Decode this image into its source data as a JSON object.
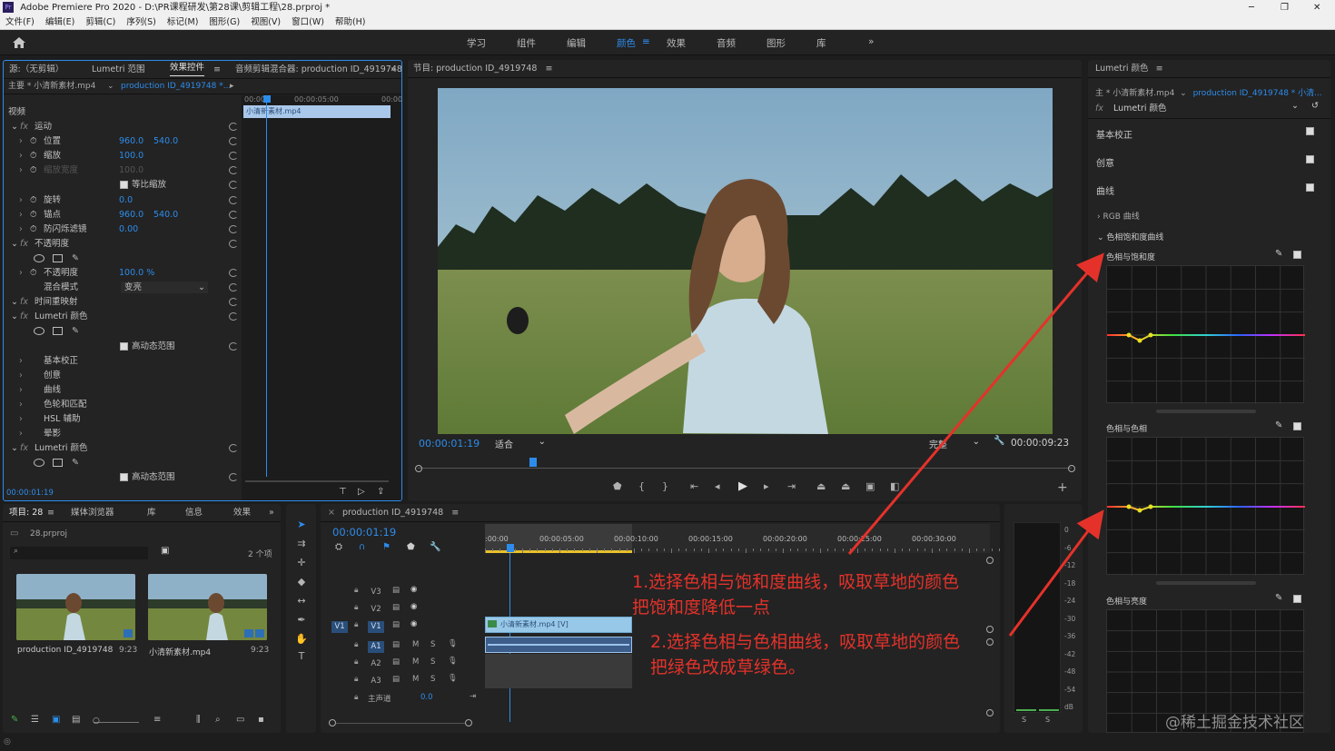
{
  "app_title": "Adobe Premiere Pro 2020 - D:\\PR课程研发\\第28课\\剪辑工程\\28.prproj *",
  "window_controls": [
    "─",
    "❐",
    "✕"
  ],
  "menu": [
    "文件(F)",
    "编辑(E)",
    "剪辑(C)",
    "序列(S)",
    "标记(M)",
    "图形(G)",
    "视图(V)",
    "窗口(W)",
    "帮助(H)"
  ],
  "workspaces": [
    "学习",
    "组件",
    "编辑",
    "颜色",
    "效果",
    "音频",
    "图形",
    "库"
  ],
  "workspace_more": "»",
  "source_panel": {
    "tabs": [
      "源:（无剪辑）",
      "Lumetri 范围",
      "效果控件",
      "音频剪辑混合器: production ID_4919748"
    ],
    "active_tab": "效果控件",
    "master": "主要 * 小清新素材.mp4",
    "sequence": "production ID_4919748 *...",
    "ruler": [
      "00:00",
      "00:00:05:00",
      "00:00"
    ],
    "clip_name": "小清新素材.mp4",
    "section": "视频",
    "rows": [
      {
        "label": "运动",
        "indent": 0,
        "fx": true
      },
      {
        "label": "位置",
        "v1": "960.0",
        "v2": "540.0"
      },
      {
        "label": "缩放",
        "v1": "100.0"
      },
      {
        "label": "缩放宽度",
        "v1": "100.0",
        "dim": true
      },
      {
        "label": "等比缩放",
        "checkbox": true
      },
      {
        "label": "旋转",
        "v1": "0.0"
      },
      {
        "label": "锚点",
        "v1": "960.0",
        "v2": "540.0"
      },
      {
        "label": "防闪烁滤镜",
        "v1": "0.00"
      },
      {
        "label": "不透明度",
        "fx": true
      },
      {
        "label": "mask-tools"
      },
      {
        "label": "不透明度",
        "v1": "100.0 %"
      },
      {
        "label": "混合模式",
        "select": "变亮"
      },
      {
        "label": "时间重映射",
        "fx": true
      },
      {
        "label": "Lumetri 颜色",
        "fx": true
      },
      {
        "label": "mask-tools"
      },
      {
        "label": "高动态范围",
        "checkbox": true
      },
      {
        "label": "基本校正"
      },
      {
        "label": "创意"
      },
      {
        "label": "曲线"
      },
      {
        "label": "色轮和匹配"
      },
      {
        "label": "HSL 辅助"
      },
      {
        "label": "晕影"
      },
      {
        "label": "Lumetri 颜色",
        "fx": true
      },
      {
        "label": "mask-tools"
      },
      {
        "label": "高动态范围",
        "checkbox": true
      }
    ],
    "timecode": "00:00:01:19"
  },
  "program_panel": {
    "title": "节目: production ID_4919748",
    "timecode": "00:00:01:19",
    "fit": "适合",
    "quality": "完整",
    "duration": "00:00:09:23"
  },
  "lumetri_panel": {
    "title": "Lumetri 颜色",
    "master": "主 * 小清新素材.mp4",
    "sequence": "production ID_4919748 * 小清...",
    "effect": "Lumetri 颜色",
    "sections": [
      "基本校正",
      "创意",
      "曲线"
    ],
    "rgb_curve": "RGB 曲线",
    "hsl_curves": "色相饱和度曲线",
    "curves": [
      "色相与饱和度",
      "色相与色相",
      "色相与亮度"
    ]
  },
  "project_panel": {
    "tabs": [
      "项目: 28",
      "媒体浏览器",
      "库",
      "信息",
      "效果"
    ],
    "file": "28.prproj",
    "count": "2 个项",
    "items": [
      {
        "name": "production ID_4919748",
        "duration": "9:23"
      },
      {
        "name": "小清新素材.mp4",
        "duration": "9:23"
      }
    ]
  },
  "timeline": {
    "title": "production ID_4919748",
    "timecode": "00:00:01:19",
    "ruler": [
      ":00:00",
      "00:00:05:00",
      "00:00:10:00",
      "00:00:15:00",
      "00:00:20:00",
      "00:00:25:00",
      "00:00:30:00"
    ],
    "video_tracks": [
      "V3",
      "V2",
      "V1"
    ],
    "audio_tracks": [
      "A1",
      "A2",
      "A3"
    ],
    "master": "主声道",
    "master_val": "0.0",
    "clip": "小清新素材.mp4 [V]",
    "meter_ticks": [
      "0",
      "-6",
      "-12",
      "-18",
      "-24",
      "-30",
      "-36",
      "-42",
      "-48",
      "-54",
      "dB"
    ],
    "meter_solo": [
      "S",
      "S"
    ]
  },
  "annotations": {
    "line1": "1.选择色相与饱和度曲线，吸取草地的颜色",
    "line2": "把饱和度降低一点",
    "line3": "2.选择色相与色相曲线，吸取草地的颜色",
    "line4": "把绿色改成草绿色。",
    "color": "#e4322a"
  },
  "watermark": "@稀土掘金技术社区"
}
